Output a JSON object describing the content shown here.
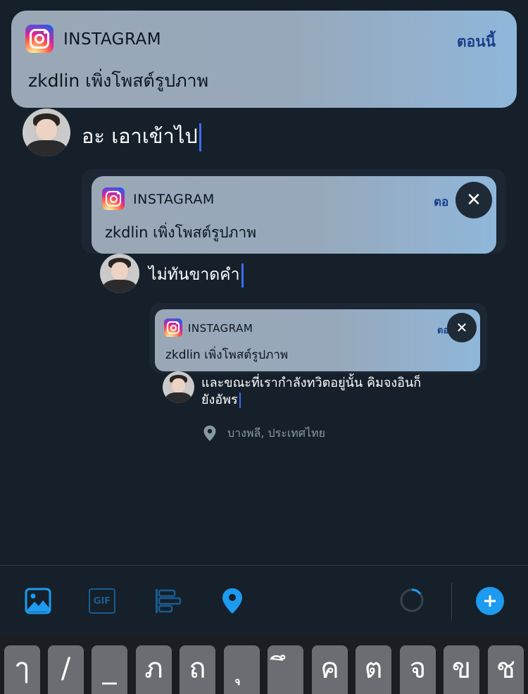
{
  "notifications": [
    {
      "app": "INSTAGRAM",
      "time": "ตอนนี้",
      "message": "zkdlin เพิ่งโพสต์รูปภาพ"
    },
    {
      "app": "INSTAGRAM",
      "time": "ตอ",
      "message": "zkdlin เพิ่งโพสต์รูปภาพ"
    },
    {
      "app": "INSTAGRAM",
      "time": "ตอ",
      "message": "zkdlin เพิ่งโพสต์รูปภาพ"
    }
  ],
  "replies": [
    {
      "text": "อะ เอาเข้าไป"
    },
    {
      "text": "ไม่ทันขาดคำ"
    },
    {
      "line1": "และขณะที่เรากำลังทวิตอยู่นั้น คิมจงอินก็",
      "line2": "ยังอัพร"
    }
  ],
  "location": "บางพลี, ประเทศไทย",
  "toolbar": {
    "image_icon": "image-icon",
    "gif_label": "GIF",
    "poll_icon": "poll-icon",
    "location_icon": "location-pin-icon",
    "progress_icon": "character-count-ring",
    "add_icon": "plus-icon",
    "accent": "#1d9bf0"
  },
  "close_glyph": "✕",
  "keyboard": {
    "keys": [
      "ๅ",
      "/",
      "_",
      "ภ",
      "ถ",
      "ุ",
      "ึ",
      "ค",
      "ต",
      "จ",
      "ข",
      "ช"
    ]
  }
}
